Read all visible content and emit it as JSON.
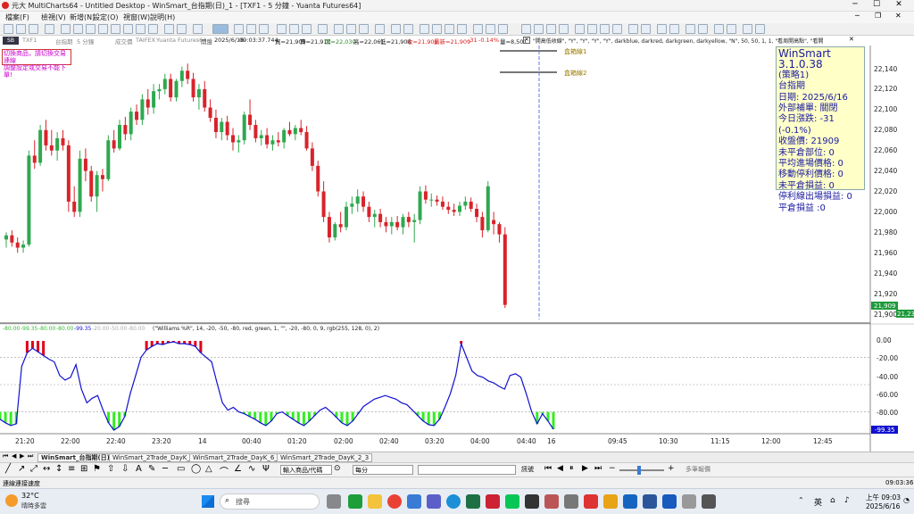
{
  "titlebar": {
    "title": "元大 MultiCharts64 - Untitled Desktop - WinSmart_台指期(日)_1 - [TXF1 - 5 分鐘 - Yuanta Futures64]"
  },
  "menu": [
    "檔案(F)",
    "檢視(V)",
    "新增(N)",
    "設定(O)",
    "視窗(W)",
    "說明(H)"
  ],
  "chartbar": {
    "sym_label": "TXF1",
    "symbol_name": "台指期",
    "interval": "5 分鐘",
    "settle": "成交價",
    "exchange": "TAIFEX",
    "source": "Yuanta Futures64",
    "status": "開盤",
    "date": "2025/6/16",
    "time": "09:03:37.744",
    "bid": "買=21,909",
    "ask": "賣=21,910",
    "open": "開=22,030",
    "high": "高=22,061",
    "low": "低=21,908",
    "close": "收=21,909",
    "last": "最新=21,909",
    "change": "-31",
    "change_pct": "-0.14%",
    "volume": "量=8,501",
    "study": "\"開高低收線\", \"Y\", \"Y\", \"Y\", \"Y\", darkblue, darkred, darkgreen, darkyellow, \"N\", 50, 50, 1, 1, \"看周開高點\", \"看開"
  },
  "input_notice": [
    "切換商品，請切換交易連線",
    "調整設定或交易不能下單!"
  ],
  "level_labels": [
    "盒箱線1",
    "盒箱線2"
  ],
  "infobox": {
    "title": "WinSmart 3.1.0.38",
    "lines": [
      "(策略1)",
      "台指期",
      "日期: 2025/6/16",
      "外部補單: 關閉",
      "今日漲跌: -31 (-0.1%)",
      "收盤價: 21909",
      "未平倉部位: 0",
      "平均進場價格: 0",
      "移動停利價格: 0",
      "未平倉損益: 0",
      "停利線出場損益: 0",
      "平倉損益 :0"
    ]
  },
  "price_axis": {
    "ticks": [
      "22,140",
      "22,120",
      "22,100",
      "22,080",
      "22,060",
      "22,040",
      "22,020",
      "22,000",
      "21,980",
      "21,960",
      "21,940",
      "21,920",
      "21,900"
    ],
    "last_tag": "21,909",
    "last_tag2": "21,23"
  },
  "indicator": {
    "header_values": [
      "-80.00",
      "-99.35",
      "-80.00",
      "-80.00",
      "-99.35",
      "-20.00",
      "-50.00",
      "-80.00"
    ],
    "header_text": "(\"Williams %R\", 14, -20, -50, -80, red, green, 1, \"\", -20, -80, 0, 9, rgb(255, 128, 0), 2)",
    "ticks": [
      "0.00",
      "-20.00",
      "-40.00",
      "-60.00",
      "-80.00"
    ],
    "last_tag": "-99.35"
  },
  "time_axis": [
    "21:20",
    "22:00",
    "22:40",
    "23:20",
    "14",
    "00:40",
    "01:20",
    "02:00",
    "02:40",
    "03:20",
    "04:00",
    "04:40",
    "16",
    "09:45",
    "10:30",
    "11:15",
    "12:00",
    "12:45"
  ],
  "colors": {
    "up": "#2fa84f",
    "down": "#d8232a",
    "wr_line": "#1010d0",
    "wr_overbought": "#e0001a",
    "wr_oversold": "#33ee22",
    "cursor": "#6677ee"
  },
  "bottom_tabs": [
    "WinSmart_台指期(日)_1",
    "WinSmart_2Trade_DayK_4_5",
    "WinSmart_2Trade_DayK_6_7",
    "WinSmart_2Trade_DayK_2_3"
  ],
  "drawbar": {
    "symbol_placeholder": "輸入商品/代碼",
    "interval": "每分",
    "mode": "訊號",
    "order": "多筆報價"
  },
  "statusbar": {
    "left": "連線連接速度",
    "right": "09:03:36"
  },
  "taskbar": {
    "weather_temp": "32°C",
    "weather_desc": "晴時多雲",
    "search": "搜尋",
    "lang": "英",
    "time": "上午 09:03",
    "date": "2025/6/16"
  },
  "chart_data": {
    "type": "candlestick",
    "price_ylim": [
      21890,
      22150
    ],
    "wr_ylim": [
      -100,
      0
    ],
    "wr_levels": [
      -20,
      -50,
      -80
    ],
    "candles": [
      [
        21973,
        21980,
        21965,
        21977
      ],
      [
        21977,
        21982,
        21966,
        21970
      ],
      [
        21970,
        21975,
        21960,
        21965
      ],
      [
        21965,
        21972,
        21960,
        21968
      ],
      [
        21968,
        22060,
        21966,
        22055
      ],
      [
        22055,
        22070,
        22042,
        22048
      ],
      [
        22048,
        22085,
        22045,
        22080
      ],
      [
        22080,
        22090,
        22060,
        22065
      ],
      [
        22065,
        22080,
        22055,
        22060
      ],
      [
        22060,
        22078,
        22050,
        22072
      ],
      [
        22072,
        22080,
        22060,
        22065
      ],
      [
        22065,
        22070,
        22000,
        22010
      ],
      [
        22010,
        22025,
        21995,
        22000
      ],
      [
        22000,
        22060,
        21995,
        22052
      ],
      [
        22052,
        22062,
        22030,
        22040
      ],
      [
        22040,
        22045,
        22010,
        22015
      ],
      [
        22015,
        22040,
        22000,
        22036
      ],
      [
        22036,
        22042,
        22020,
        22032
      ],
      [
        22032,
        22075,
        22030,
        22070
      ],
      [
        22070,
        22080,
        22058,
        22062
      ],
      [
        22062,
        22090,
        22060,
        22085
      ],
      [
        22085,
        22093,
        22070,
        22076
      ],
      [
        22076,
        22102,
        22070,
        22098
      ],
      [
        22098,
        22105,
        22085,
        22090
      ],
      [
        22090,
        22115,
        22085,
        22110
      ],
      [
        22110,
        22120,
        22095,
        22102
      ],
      [
        22102,
        22125,
        22096,
        22118
      ],
      [
        22118,
        22125,
        22110,
        22120
      ],
      [
        22120,
        22135,
        22115,
        22130
      ],
      [
        22130,
        22135,
        22108,
        22112
      ],
      [
        22112,
        22130,
        22108,
        22128
      ],
      [
        22128,
        22142,
        22122,
        22138
      ],
      [
        22138,
        22145,
        22125,
        22130
      ],
      [
        22130,
        22136,
        22108,
        22112
      ],
      [
        22112,
        22125,
        22100,
        22120
      ],
      [
        22120,
        22128,
        22098,
        22102
      ],
      [
        22102,
        22110,
        22088,
        22092
      ],
      [
        22092,
        22100,
        22072,
        22078
      ],
      [
        22078,
        22092,
        22070,
        22088
      ],
      [
        22088,
        22094,
        22070,
        22075
      ],
      [
        22075,
        22082,
        22060,
        22068
      ],
      [
        22068,
        22075,
        22058,
        22070
      ],
      [
        22070,
        22098,
        22066,
        22095
      ],
      [
        22095,
        22110,
        22080,
        22085
      ],
      [
        22085,
        22090,
        22068,
        22072
      ],
      [
        22072,
        22080,
        22065,
        22075
      ],
      [
        22075,
        22082,
        22062,
        22066
      ],
      [
        22066,
        22075,
        22060,
        22070
      ],
      [
        22070,
        22078,
        22064,
        22068
      ],
      [
        22068,
        22082,
        22062,
        22080
      ],
      [
        22080,
        22088,
        22074,
        22076
      ],
      [
        22076,
        22085,
        22070,
        22082
      ],
      [
        22082,
        22090,
        22075,
        22078
      ],
      [
        22078,
        22084,
        22060,
        22062
      ],
      [
        22062,
        22068,
        22040,
        22045
      ],
      [
        22045,
        22050,
        22015,
        22020
      ],
      [
        22020,
        22030,
        21990,
        21995
      ],
      [
        21995,
        22000,
        21970,
        21975
      ],
      [
        21975,
        21990,
        21972,
        21988
      ],
      [
        21988,
        22000,
        21980,
        21985
      ],
      [
        21985,
        22010,
        21982,
        22005
      ],
      [
        22005,
        22015,
        21998,
        22008
      ],
      [
        22008,
        22022,
        22000,
        22015
      ],
      [
        22015,
        22020,
        22000,
        22005
      ],
      [
        22005,
        22010,
        21990,
        21995
      ],
      [
        21995,
        22002,
        21985,
        21998
      ],
      [
        21998,
        22003,
        21985,
        21990
      ],
      [
        21990,
        21995,
        21980,
        21986
      ],
      [
        21986,
        21995,
        21978,
        21990
      ],
      [
        21990,
        21996,
        21982,
        21985
      ],
      [
        21985,
        21998,
        21978,
        21995
      ],
      [
        21995,
        22000,
        21985,
        21990
      ],
      [
        21990,
        21998,
        21970,
        21992
      ],
      [
        21992,
        22025,
        21988,
        22020
      ],
      [
        22020,
        22026,
        22008,
        22012
      ],
      [
        22012,
        22018,
        22005,
        22012
      ],
      [
        22012,
        22016,
        22006,
        22010
      ],
      [
        22010,
        22015,
        22002,
        22005
      ],
      [
        22005,
        22010,
        21998,
        22002
      ],
      [
        22002,
        22008,
        21996,
        22000
      ],
      [
        22000,
        22010,
        21996,
        22006
      ],
      [
        22006,
        22015,
        22002,
        22010
      ],
      [
        22010,
        22014,
        22000,
        22003
      ],
      [
        22003,
        22008,
        21990,
        21995
      ],
      [
        21995,
        22000,
        21975,
        21982
      ],
      [
        21982,
        22030,
        21980,
        22025
      ],
      [
        21992,
        22000,
        21978,
        21988
      ],
      [
        21988,
        21990,
        21970,
        21978
      ],
      [
        21978,
        21985,
        21906,
        21909
      ]
    ],
    "williams_r": [
      -88,
      -92,
      -95,
      -93,
      -30,
      -15,
      -10,
      -14,
      -18,
      -22,
      -25,
      -40,
      -45,
      -42,
      -28,
      -55,
      -70,
      -65,
      -62,
      -78,
      -92,
      -100,
      -96,
      -85,
      -60,
      -40,
      -20,
      -12,
      -8,
      -5,
      -6,
      -4,
      -3,
      -5,
      -5,
      -6,
      -8,
      -15,
      -20,
      -25,
      -48,
      -70,
      -78,
      -75,
      -80,
      -82,
      -85,
      -88,
      -92,
      -95,
      -90,
      -82,
      -80,
      -84,
      -88,
      -92,
      -95,
      -90,
      -84,
      -78,
      -75,
      -80,
      -86,
      -92,
      -95,
      -90,
      -82,
      -74,
      -70,
      -66,
      -64,
      -62,
      -64,
      -66,
      -70,
      -72,
      -78,
      -84,
      -90,
      -94,
      -95,
      -88,
      -75,
      -60,
      -40,
      -5,
      -20,
      -35,
      -40,
      -42,
      -46,
      -48,
      -52,
      -55,
      -40,
      -38,
      -42,
      -60,
      -80,
      -93,
      -82,
      -90,
      -99
    ]
  }
}
